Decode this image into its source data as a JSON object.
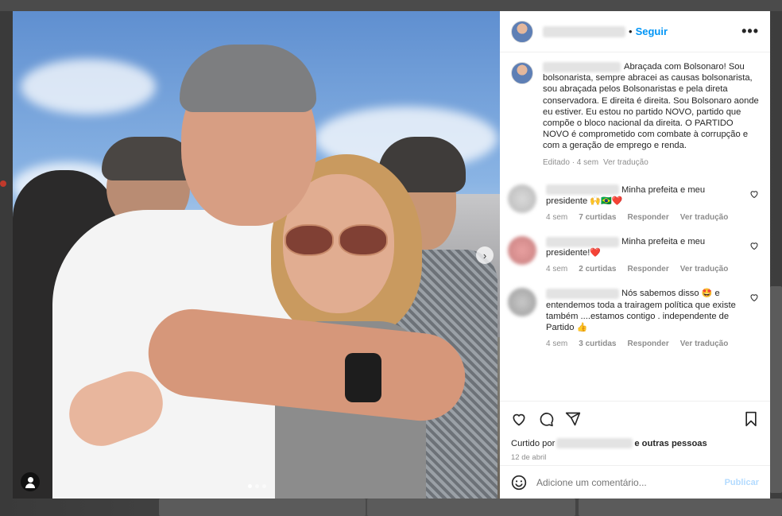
{
  "post": {
    "follow_label": "Seguir",
    "more_label": "•••",
    "dot_separator": "•",
    "caption": {
      "text": "Abraçada com Bolsonaro! Sou bolsonarista, sempre abracei as causas bolsonarista, sou abraçada pelos Bolsonaristas e pela direta conservadora. E direita é direita. Sou Bolsonaro aonde eu estiver. Eu estou no partido NOVO, partido que compõe o bloco nacional da direita. O PARTIDO NOVO é comprometido com combate à corrupção e com a geração de emprego e renda.",
      "edited": "Editado · 4 sem",
      "translate": "Ver tradução"
    },
    "comments": [
      {
        "text": "Minha prefeita e meu presidente",
        "emoji": "🙌🇧🇷❤️",
        "time": "4 sem",
        "likes": "7 curtidas",
        "reply": "Responder",
        "translate": "Ver tradução"
      },
      {
        "text": "Minha prefeita e meu presidente!",
        "emoji": "❤️",
        "time": "4 sem",
        "likes": "2 curtidas",
        "reply": "Responder",
        "translate": "Ver tradução"
      },
      {
        "text_a": "Nós sabemos disso",
        "emoji_a": "🤩",
        "text_b": "e entendemos toda a trairagem política que existe também ....estamos contigo . independente de Partido",
        "emoji_b": "👍",
        "time": "4 sem",
        "likes": "3 curtidas",
        "reply": "Responder",
        "translate": "Ver tradução"
      }
    ],
    "liked_by_prefix": "Curtido por",
    "liked_by_suffix": "e outras pessoas",
    "date": "12 de abril",
    "add_comment_placeholder": "Adicione um comentário...",
    "publish_label": "Publicar",
    "carousel": {
      "slides": 3,
      "active": 1
    }
  },
  "colors": {
    "accent": "#0095f6",
    "heart": "#ed4956",
    "muted": "#8e8e8e"
  }
}
